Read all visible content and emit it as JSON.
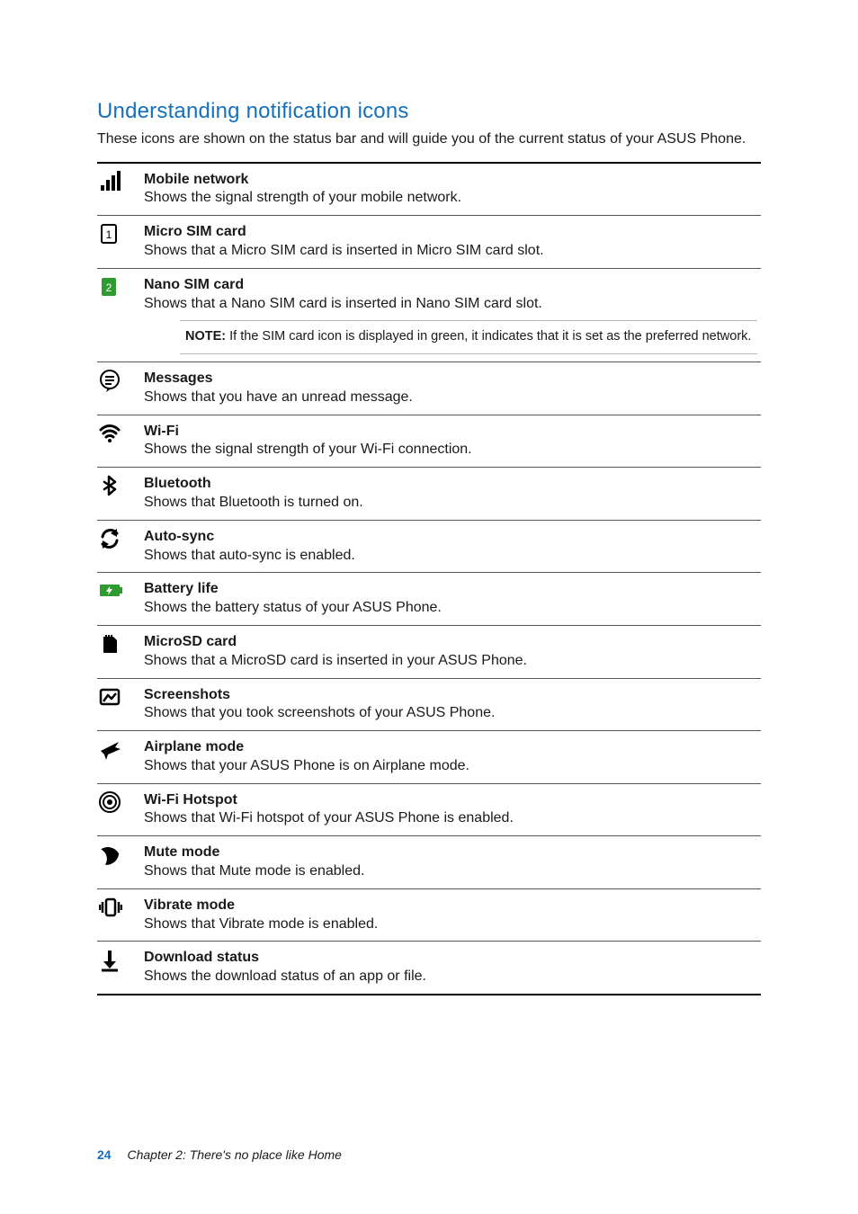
{
  "section_title": "Understanding notification icons",
  "intro": "These icons are shown on the status bar and will guide you of the current status of your ASUS Phone.",
  "note": {
    "label": "NOTE:",
    "text": " If the SIM card icon is displayed in green, it indicates that it is set as the preferred network."
  },
  "rows": [
    {
      "icon": "signal-icon",
      "title": "Mobile network",
      "desc": "Shows the signal strength of your mobile network."
    },
    {
      "icon": "sim1-icon",
      "title": "Micro SIM card",
      "desc": "Shows that a Micro SIM card is inserted in Micro SIM card slot."
    },
    {
      "icon": "sim2-icon",
      "title": "Nano SIM card",
      "desc": "Shows that a Nano SIM card is inserted in Nano SIM card slot.",
      "note_after": true
    },
    {
      "icon": "messages-icon",
      "title": "Messages",
      "desc": "Shows that you have an unread message."
    },
    {
      "icon": "wifi-icon",
      "title": "Wi-Fi",
      "desc": "Shows the signal strength of your Wi-Fi connection."
    },
    {
      "icon": "bluetooth-icon",
      "title": "Bluetooth",
      "desc": "Shows that Bluetooth is turned on."
    },
    {
      "icon": "autosync-icon",
      "title": "Auto-sync",
      "desc": "Shows that auto-sync is enabled."
    },
    {
      "icon": "battery-icon",
      "title": "Battery life",
      "desc": "Shows the battery status of your ASUS Phone."
    },
    {
      "icon": "microsd-icon",
      "title": "MicroSD card",
      "desc": "Shows that a MicroSD card is inserted in your ASUS Phone."
    },
    {
      "icon": "screenshots-icon",
      "title": "Screenshots",
      "desc": "Shows that you took screenshots of your ASUS Phone."
    },
    {
      "icon": "airplane-icon",
      "title": "Airplane mode",
      "desc": "Shows that your ASUS Phone is on Airplane mode."
    },
    {
      "icon": "wifi-hotspot-icon",
      "title": "Wi-Fi Hotspot",
      "desc": "Shows that Wi-Fi hotspot of your ASUS Phone is enabled."
    },
    {
      "icon": "mute-icon",
      "title": "Mute mode",
      "desc": "Shows that Mute mode is enabled."
    },
    {
      "icon": "vibrate-icon",
      "title": "Vibrate mode",
      "desc": "Shows that Vibrate mode is enabled."
    },
    {
      "icon": "download-icon",
      "title": "Download status",
      "desc": "Shows the download status of an app or file."
    }
  ],
  "footer": {
    "page_number": "24",
    "chapter": "Chapter 2:  There's no place like Home"
  }
}
